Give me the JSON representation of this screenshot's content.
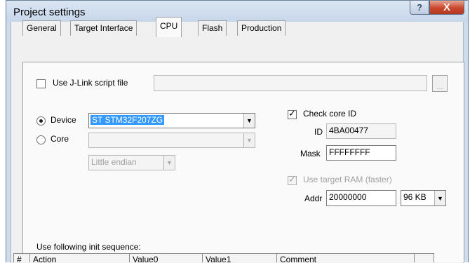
{
  "window": {
    "title": "Project settings",
    "help_label": "?",
    "close_label": "X"
  },
  "tabs": [
    {
      "label": "General"
    },
    {
      "label": "Target Interface"
    },
    {
      "label": "CPU"
    },
    {
      "label": "Flash"
    },
    {
      "label": "Production"
    }
  ],
  "active_tab": "CPU",
  "script_file": {
    "label": "Use J-Link script file",
    "checked": false,
    "value": "",
    "browse_label": "..."
  },
  "device": {
    "label": "Device",
    "selected": true,
    "value": "ST STM32F207ZG"
  },
  "core": {
    "label": "Core",
    "selected": false,
    "value": "",
    "endian": "Little endian"
  },
  "check_core_id": {
    "label": "Check core ID",
    "checked": true,
    "id_label": "ID",
    "id_value": "4BA00477",
    "mask_label": "Mask",
    "mask_value": "FFFFFFFF"
  },
  "target_ram": {
    "label": "Use target RAM (faster)",
    "checked": true,
    "addr_label": "Addr",
    "addr_value": "20000000",
    "size_value": "96 KB"
  },
  "init_sequence": {
    "label": "Use following init sequence:",
    "columns": [
      "#",
      "Action",
      "Value0",
      "Value1",
      "Comment"
    ]
  },
  "icons": {
    "dropdown": "chevron-down-icon",
    "check": "check-icon"
  }
}
